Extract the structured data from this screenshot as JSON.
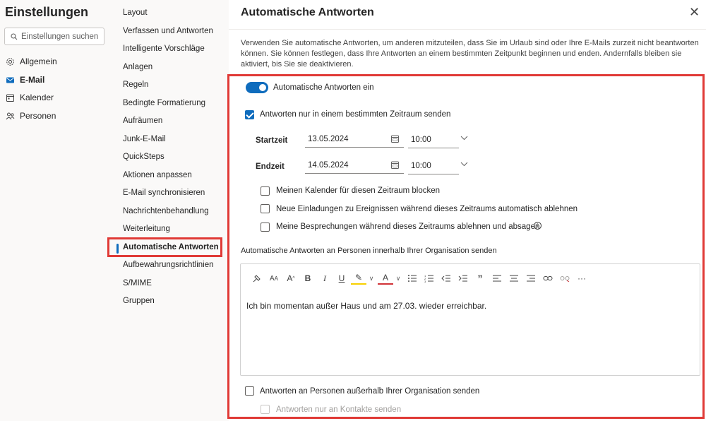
{
  "nav": {
    "title": "Einstellungen",
    "search_placeholder": "Einstellungen suchen",
    "items": [
      {
        "label": "Allgemein",
        "icon": "gear-icon"
      },
      {
        "label": "E-Mail",
        "icon": "mail-icon",
        "active": true
      },
      {
        "label": "Kalender",
        "icon": "calendar-icon"
      },
      {
        "label": "Personen",
        "icon": "people-icon"
      }
    ]
  },
  "subnav": {
    "items": [
      "Layout",
      "Verfassen und Antworten",
      "Intelligente Vorschläge",
      "Anlagen",
      "Regeln",
      "Bedingte Formatierung",
      "Aufräumen",
      "Junk-E-Mail",
      "QuickSteps",
      "Aktionen anpassen",
      "E-Mail synchronisieren",
      "Nachrichtenbehandlung",
      "Weiterleitung",
      "Automatische Antworten",
      "Aufbewahrungsrichtlinien",
      "S/MIME",
      "Gruppen"
    ],
    "active": "Automatische Antworten"
  },
  "main": {
    "title": "Automatische Antworten",
    "close": "✕",
    "description": "Verwenden Sie automatische Antworten, um anderen mitzuteilen, dass Sie im Urlaub sind oder Ihre E-Mails zurzeit nicht beantworten können. Sie können festlegen, dass Ihre Antworten an einem bestimmten Zeitpunkt beginnen und enden. Andernfalls bleiben sie aktiviert, bis Sie sie deaktivieren.",
    "toggle_label": "Automatische Antworten ein",
    "toggle_on": true,
    "time_range_label": "Antworten nur in einem bestimmten Zeitraum senden",
    "time_range_checked": true,
    "start_label": "Startzeit",
    "start_date": "13.05.2024",
    "start_time": "10:00",
    "end_label": "Endzeit",
    "end_date": "14.05.2024",
    "end_time": "10:00",
    "option_block_calendar": "Meinen Kalender für diesen Zeitraum blocken",
    "option_decline_invites": "Neue Einladungen zu Ereignissen während dieses Zeitraums automatisch ablehnen",
    "option_decline_meetings": "Meine Besprechungen während dieses Zeitraums ablehnen und absagen",
    "internal_heading": "Automatische Antworten an Personen innerhalb Ihrer Organisation senden",
    "editor_text": "Ich bin momentan außer Haus und am 27.03. wieder erreichbar.",
    "external_label": "Antworten an Personen außerhalb Ihrer Organisation senden",
    "contacts_only_label": "Antworten nur an Kontakte senden"
  },
  "toolbar": {
    "format_painter": "🖌",
    "font_size": "A",
    "font_size_small": "A",
    "grow": "A",
    "bold": "B",
    "italic": "I",
    "underline": "U",
    "highlight": "✎",
    "font_color": "A",
    "more": "···"
  },
  "colors": {
    "accent": "#0f6cbd",
    "annotation": "#e03a36"
  }
}
